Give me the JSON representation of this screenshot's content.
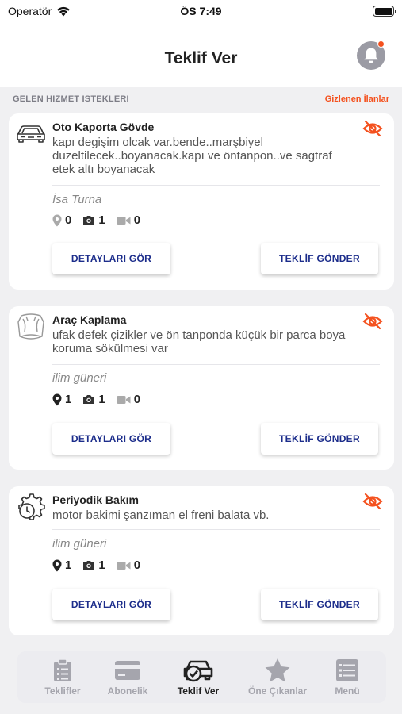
{
  "status_bar": {
    "carrier": "Operatör",
    "time": "ÖS 7:49"
  },
  "header": {
    "title": "Teklif Ver"
  },
  "section": {
    "label": "GELEN HIZMET ISTEKLERI",
    "hidden_link": "Gizlenen İlanlar"
  },
  "requests": [
    {
      "icon": "car-icon",
      "title": "Oto Kaporta Gövde",
      "description": "kapı degişim olcak var.bende..marşbiyel duzeltilecek..boyanacak.kapı ve öntanpon..ve sagtraf etek altı boyanacak",
      "owner": "İsa Turna",
      "locations": "0",
      "photos": "1",
      "videos": "0",
      "details_label": "DETAYLARI GÖR",
      "offer_label": "TEKLİF GÖNDER"
    },
    {
      "icon": "car-wrap-icon",
      "title": "Araç Kaplama",
      "description": "ufak defek çizikler ve ön tanponda küçük bir parca boya koruma sökülmesi var",
      "owner": "ilim güneri",
      "locations": "1",
      "photos": "1",
      "videos": "0",
      "details_label": "DETAYLARI GÖR",
      "offer_label": "TEKLİF GÖNDER"
    },
    {
      "icon": "gear-clock-icon",
      "title": "Periyodik Bakım",
      "description": "motor bakimi şanzıman el freni balata vb.",
      "owner": "ilim güneri",
      "locations": "1",
      "photos": "1",
      "videos": "0",
      "details_label": "DETAYLARI GÖR",
      "offer_label": "TEKLİF GÖNDER"
    }
  ],
  "tabs": [
    {
      "label": "Teklifler",
      "icon": "clipboard-icon",
      "active": false
    },
    {
      "label": "Abonelik",
      "icon": "card-icon",
      "active": false
    },
    {
      "label": "Teklif Ver",
      "icon": "car-check-icon",
      "active": true
    },
    {
      "label": "Öne Çıkanlar",
      "icon": "star-icon",
      "active": false
    },
    {
      "label": "Menü",
      "icon": "menu-icon",
      "active": false
    }
  ],
  "colors": {
    "accent": "#f4511e",
    "button_text": "#1c2d8b",
    "background": "#f0f0f2"
  }
}
